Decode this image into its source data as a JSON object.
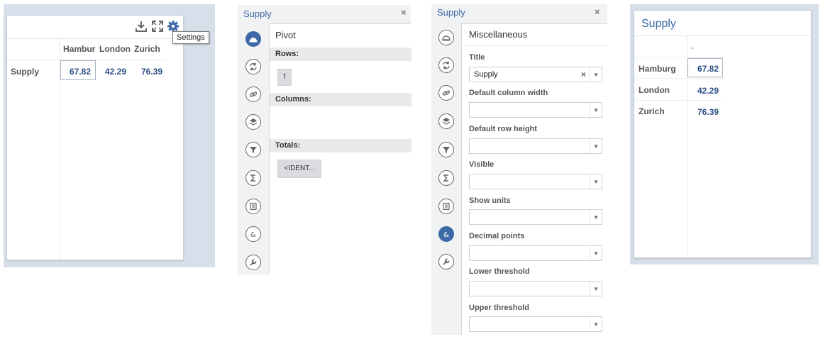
{
  "table_widget": {
    "tooltip": "Settings",
    "columns": [
      "Hamburg",
      "London",
      "Zurich"
    ],
    "row_label": "Supply",
    "values": [
      "67.82",
      "42.29",
      "76.39"
    ],
    "icons": [
      "download-icon",
      "fullscreen-icon",
      "gear-icon"
    ]
  },
  "pivot_panel": {
    "title": "Supply",
    "close": "×",
    "heading": "Pivot",
    "rows_label": "Rows:",
    "rows_chip": "f",
    "columns_label": "Columns:",
    "totals_label": "Totals:",
    "totals_chip": "<IDENT..."
  },
  "misc_panel": {
    "title": "Supply",
    "close": "×",
    "heading": "Miscellaneous",
    "fields": [
      {
        "label": "Title",
        "value": "Supply"
      },
      {
        "label": "Default column width",
        "value": ""
      },
      {
        "label": "Default row height",
        "value": ""
      },
      {
        "label": "Visible",
        "value": ""
      },
      {
        "label": "Show units",
        "value": ""
      },
      {
        "label": "Decimal points",
        "value": ""
      },
      {
        "label": "Lower threshold",
        "value": ""
      },
      {
        "label": "Upper threshold",
        "value": ""
      }
    ],
    "clear_glyph": "×",
    "arrow_glyph": "▼"
  },
  "transposed_widget": {
    "title": "Supply",
    "column_header": "-",
    "rows": [
      {
        "label": "Hamburg",
        "value": "67.82"
      },
      {
        "label": "London",
        "value": "42.29"
      },
      {
        "label": "Zurich",
        "value": "76.39"
      }
    ]
  },
  "rail_icons": [
    "pivot-icon",
    "refresh-icon",
    "link-icon",
    "layers-icon",
    "filter-icon",
    "sigma-icon",
    "list-icon",
    "ampersand-icon",
    "wrench-icon"
  ],
  "colors": {
    "accent": "#3d6aa6",
    "value": "#2c4f86",
    "background": "#d7dfea"
  }
}
